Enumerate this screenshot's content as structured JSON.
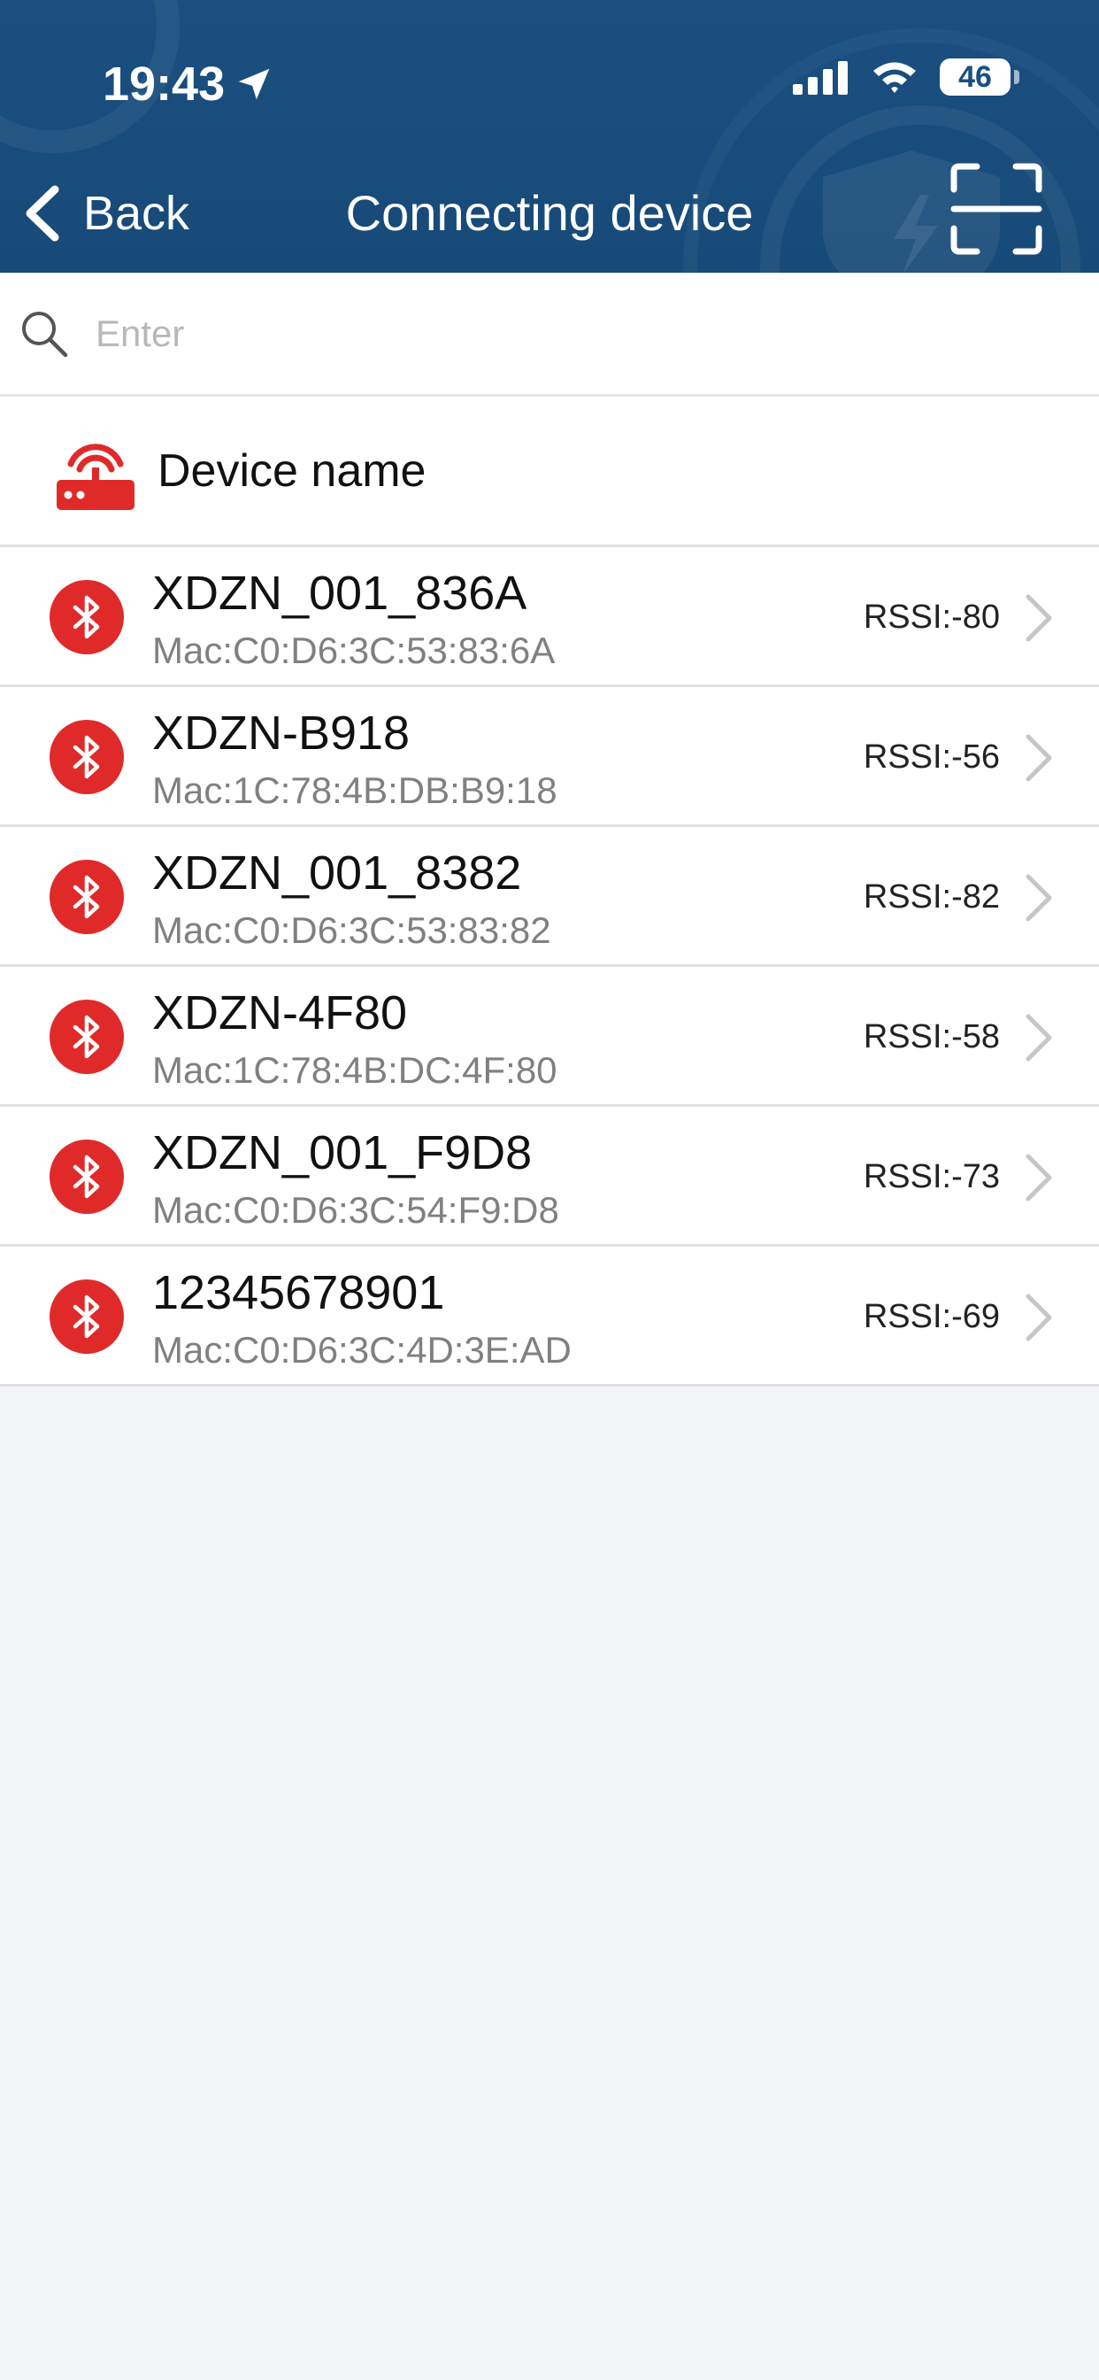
{
  "status_bar": {
    "time": "19:43",
    "battery": "46",
    "icons": [
      "location-arrow-icon",
      "signal-icon",
      "wifi-icon",
      "battery-icon"
    ]
  },
  "nav": {
    "back_label": "Back",
    "title": "Connecting device",
    "scan_icon": "scan-icon"
  },
  "search": {
    "placeholder": "Enter",
    "value": ""
  },
  "list_header": {
    "title": "Device name",
    "icon": "router-icon"
  },
  "devices": [
    {
      "name": "XDZN_001_836A",
      "mac": "Mac:C0:D6:3C:53:83:6A",
      "rssi": "RSSI:-80"
    },
    {
      "name": "XDZN-B918",
      "mac": "Mac:1C:78:4B:DB:B9:18",
      "rssi": "RSSI:-56"
    },
    {
      "name": "XDZN_001_8382",
      "mac": "Mac:C0:D6:3C:53:83:82",
      "rssi": "RSSI:-82"
    },
    {
      "name": "XDZN-4F80",
      "mac": "Mac:1C:78:4B:DC:4F:80",
      "rssi": "RSSI:-58"
    },
    {
      "name": "XDZN_001_F9D8",
      "mac": "Mac:C0:D6:3C:54:F9:D8",
      "rssi": "RSSI:-73"
    },
    {
      "name": "12345678901",
      "mac": "Mac:C0:D6:3C:4D:3E:AD",
      "rssi": "RSSI:-69"
    }
  ],
  "colors": {
    "header_bg": "#1a4f80",
    "accent_red": "#e02a2a",
    "page_bg": "#f4f5f9"
  }
}
